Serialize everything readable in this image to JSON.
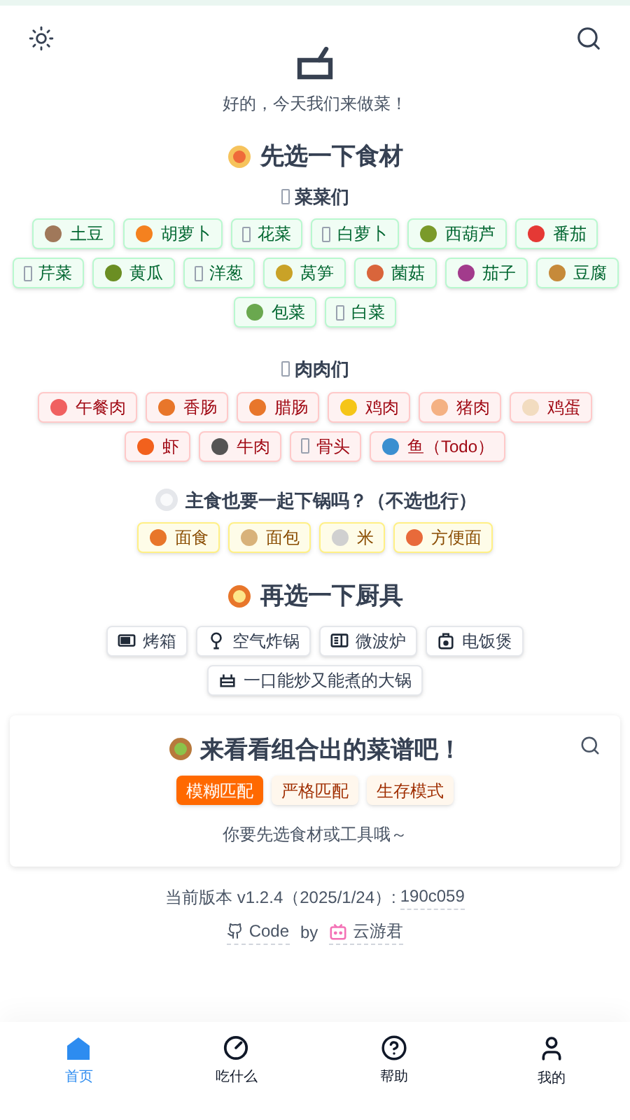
{
  "header": {
    "subtitle": "好的，今天我们来做菜！"
  },
  "ingredients": {
    "title": "先选一下食材",
    "vegetables": {
      "title": "菜菜们",
      "items": [
        {
          "label": "土豆",
          "kind": "emoji",
          "color": "#a0785a",
          "selected": false
        },
        {
          "label": "胡萝卜",
          "kind": "emoji",
          "color": "#f4811f",
          "selected": false
        },
        {
          "label": "花菜",
          "kind": "missing",
          "selected": false
        },
        {
          "label": "白萝卜",
          "kind": "missing",
          "selected": false
        },
        {
          "label": "西葫芦",
          "kind": "emoji",
          "color": "#7a9a2a",
          "selected": false
        },
        {
          "label": "番茄",
          "kind": "emoji",
          "color": "#e53935",
          "selected": false
        },
        {
          "label": "芹菜",
          "kind": "missing",
          "selected": false
        },
        {
          "label": "黄瓜",
          "kind": "emoji",
          "color": "#6b8e23",
          "selected": false
        },
        {
          "label": "洋葱",
          "kind": "missing",
          "selected": false
        },
        {
          "label": "莴笋",
          "kind": "emoji",
          "color": "#c9a227",
          "selected": false
        },
        {
          "label": "菌菇",
          "kind": "emoji",
          "color": "#d9653b",
          "selected": false
        },
        {
          "label": "茄子",
          "kind": "emoji",
          "color": "#a23b8c",
          "selected": false
        },
        {
          "label": "豆腐",
          "kind": "emoji",
          "color": "#c68a3a",
          "selected": false
        },
        {
          "label": "包菜",
          "kind": "emoji",
          "color": "#6aa84f",
          "selected": false
        },
        {
          "label": "白菜",
          "kind": "missing",
          "selected": false
        }
      ]
    },
    "meats": {
      "title": "肉肉们",
      "items": [
        {
          "label": "午餐肉",
          "kind": "emoji",
          "color": "#f06060",
          "selected": false
        },
        {
          "label": "香肠",
          "kind": "emoji",
          "color": "#e8762a",
          "selected": false
        },
        {
          "label": "腊肠",
          "kind": "emoji",
          "color": "#e8762b",
          "selected": false
        },
        {
          "label": "鸡肉",
          "kind": "emoji",
          "color": "#f5c518",
          "selected": false
        },
        {
          "label": "猪肉",
          "kind": "emoji",
          "color": "#f4b183",
          "selected": false
        },
        {
          "label": "鸡蛋",
          "kind": "emoji",
          "color": "#f2dcc0",
          "selected": false
        },
        {
          "label": "虾",
          "kind": "emoji",
          "color": "#f2611d",
          "selected": false
        },
        {
          "label": "牛肉",
          "kind": "emoji",
          "color": "#555555",
          "selected": false
        },
        {
          "label": "骨头",
          "kind": "missing",
          "selected": false
        },
        {
          "label": "鱼（Todo）",
          "kind": "emoji",
          "color": "#3a8fd0",
          "selected": false
        }
      ]
    }
  },
  "staples": {
    "title": "主食也要一起下锅吗？（不选也行）",
    "items": [
      {
        "label": "面食",
        "kind": "emoji",
        "color": "#e8762a",
        "selected": false
      },
      {
        "label": "面包",
        "kind": "emoji",
        "color": "#d8b27a",
        "selected": false
      },
      {
        "label": "米",
        "kind": "emoji",
        "color": "#d0d0d0",
        "selected": false
      },
      {
        "label": "方便面",
        "kind": "emoji",
        "color": "#e86a3a",
        "selected": false
      }
    ]
  },
  "tools": {
    "title": "再选一下厨具",
    "items": [
      {
        "label": "烤箱",
        "kind": "oven",
        "selected": false
      },
      {
        "label": "空气炸锅",
        "kind": "fryer",
        "selected": false
      },
      {
        "label": "微波炉",
        "kind": "microwave",
        "selected": false
      },
      {
        "label": "电饭煲",
        "kind": "cooker",
        "selected": false
      },
      {
        "label": "一口能炒又能煮的大锅",
        "kind": "pot",
        "selected": false
      }
    ]
  },
  "recipes": {
    "title": "来看看组合出的菜谱吧！",
    "modes": [
      {
        "label": "模糊匹配",
        "selected": true
      },
      {
        "label": "严格匹配",
        "selected": false
      },
      {
        "label": "生存模式",
        "selected": false
      }
    ],
    "message": "你要先选食材或工具哦～"
  },
  "footer": {
    "version": "当前版本 v1.2.4（2025/1/24）:",
    "commit": "190c059",
    "code_link": "Code",
    "by": "by",
    "author": "云游君"
  },
  "nav": [
    {
      "label": "首页",
      "selected": true
    },
    {
      "label": "吃什么",
      "selected": false
    },
    {
      "label": "帮助",
      "selected": false
    },
    {
      "label": "我的",
      "selected": false
    }
  ]
}
